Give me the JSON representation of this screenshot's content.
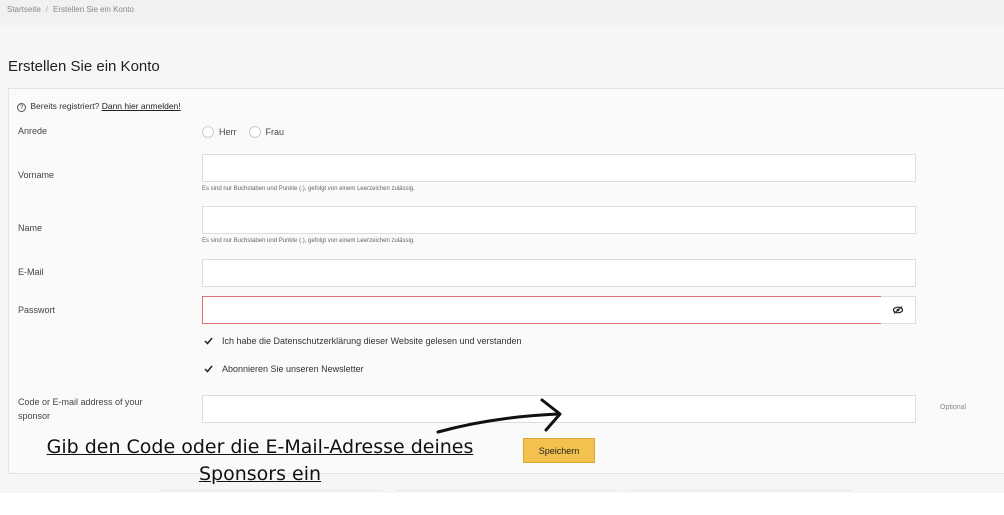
{
  "breadcrumb": {
    "home": "Startseite",
    "separator": "/",
    "current": "Erstellen Sie ein Konto"
  },
  "page": {
    "title": "Erstellen Sie ein Konto"
  },
  "form": {
    "login_prompt": "Bereits registriert?",
    "login_link": "Dann hier anmelden!",
    "salutation": {
      "label": "Anrede",
      "options": [
        "Herr",
        "Frau"
      ]
    },
    "firstname": {
      "label": "Vorname",
      "value": "",
      "hint": "Es sind nur Buchstaben und Punkte (.), gefolgt von einem Leerzeichen zulässig."
    },
    "lastname": {
      "label": "Name",
      "value": "",
      "hint": "Es sind nur Buchstaben und Punkte (.), gefolgt von einem Leerzeichen zulässig."
    },
    "email": {
      "label": "E-Mail",
      "value": ""
    },
    "password": {
      "label": "Passwort",
      "value": ""
    },
    "privacy_checkbox": {
      "label": "Ich habe die Datenschutzerklärung dieser Website gelesen und verstanden",
      "checked": true
    },
    "newsletter_checkbox": {
      "label": "Abonnieren Sie unseren Newsletter",
      "checked": true
    },
    "sponsor": {
      "label_line1": "Code or E-mail address of your",
      "label_line2": "sponsor",
      "value": "",
      "optional": "Optional"
    },
    "save_label": "Speichern"
  },
  "annotation": {
    "line1": "Gib den Code oder die E-Mail-Adresse deines",
    "line2": "Sponsors ein"
  },
  "colors": {
    "button": "#f2c14e",
    "error_border": "#e07070"
  }
}
